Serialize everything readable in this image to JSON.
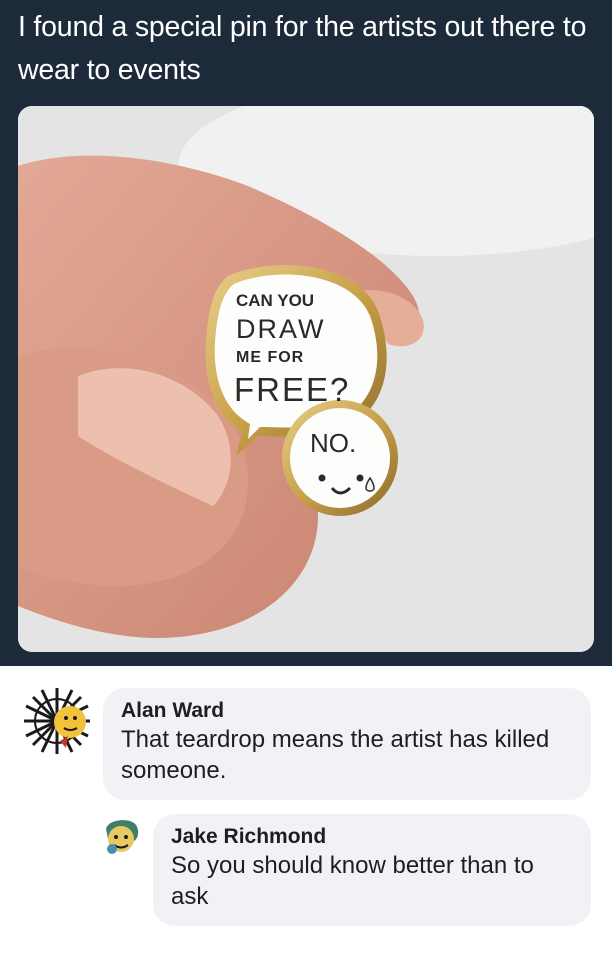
{
  "post": {
    "caption": "I found a special pin for the artists out there to wear to events"
  },
  "pin": {
    "line1": "CAN YOU",
    "line2": "DRAW",
    "line3": "ME FOR",
    "line4": "FREE?",
    "reply": "NO."
  },
  "comments": [
    {
      "author": "Alan Ward",
      "text": "That teardrop means the artist has killed someone."
    },
    {
      "author": "Jake Richmond",
      "text": "So you should know better than to ask"
    }
  ],
  "colors": {
    "tweet_background": "#1c2a3a",
    "comment_bubble": "#f0f2f5",
    "pin_gold": "#c9a14a"
  }
}
